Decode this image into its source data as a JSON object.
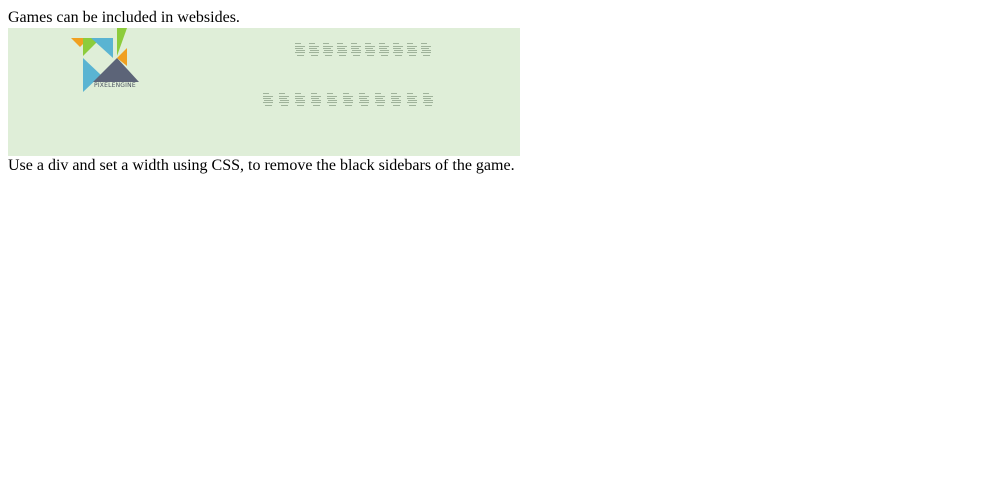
{
  "intro_text": "Games can be included in websides.",
  "outro_text": "Use a div and set a width using CSS, to remove the black sidebars of the game.",
  "game": {
    "background_color": "#dfeed8",
    "logo": {
      "label": "PIXELENGINE",
      "icon": "pixelengine-logo-icon",
      "colors": [
        "#f0a020",
        "#8ccc3c",
        "#5ab4d2",
        "#5c6478"
      ]
    },
    "tile_row_1_count": 10,
    "tile_row_2_count": 11,
    "tile_color": "#9fb29a"
  }
}
